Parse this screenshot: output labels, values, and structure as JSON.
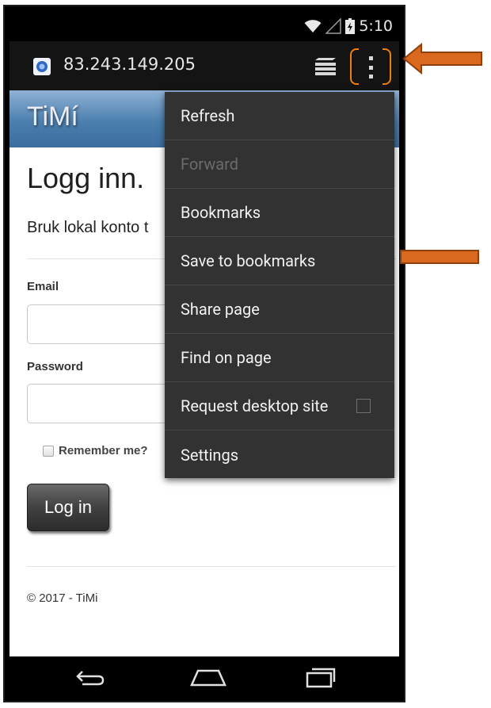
{
  "status_bar": {
    "time": "5:10",
    "icons": [
      "wifi-icon",
      "signal-icon",
      "battery-icon"
    ]
  },
  "browser": {
    "url": "83.243.149.205",
    "icons": [
      "globe-icon",
      "tabs-icon",
      "overflow-menu-icon"
    ]
  },
  "page": {
    "logo": "TiMí",
    "heading": "Logg inn.",
    "subheading": "Bruk lokal konto t",
    "email_label": "Email",
    "email_value": "",
    "password_label": "Password",
    "password_value": "",
    "remember_label": "Remember me?",
    "login_button": "Log in",
    "footer": "© 2017 - TiMi"
  },
  "menu": {
    "items": [
      {
        "label": "Refresh",
        "enabled": true
      },
      {
        "label": "Forward",
        "enabled": false
      },
      {
        "label": "Bookmarks",
        "enabled": true
      },
      {
        "label": "Save to bookmarks",
        "enabled": true
      },
      {
        "label": "Share page",
        "enabled": true
      },
      {
        "label": "Find on page",
        "enabled": true
      },
      {
        "label": "Request desktop site",
        "enabled": true,
        "checked": false
      },
      {
        "label": "Settings",
        "enabled": true
      }
    ]
  },
  "nav": {
    "icons": [
      "back-icon",
      "home-icon",
      "recents-icon"
    ]
  },
  "colors": {
    "highlight": "#f07d13",
    "annotation_arrow": "#d9691e",
    "menu_bg": "#323232",
    "header_blue": "#4b7fae"
  }
}
